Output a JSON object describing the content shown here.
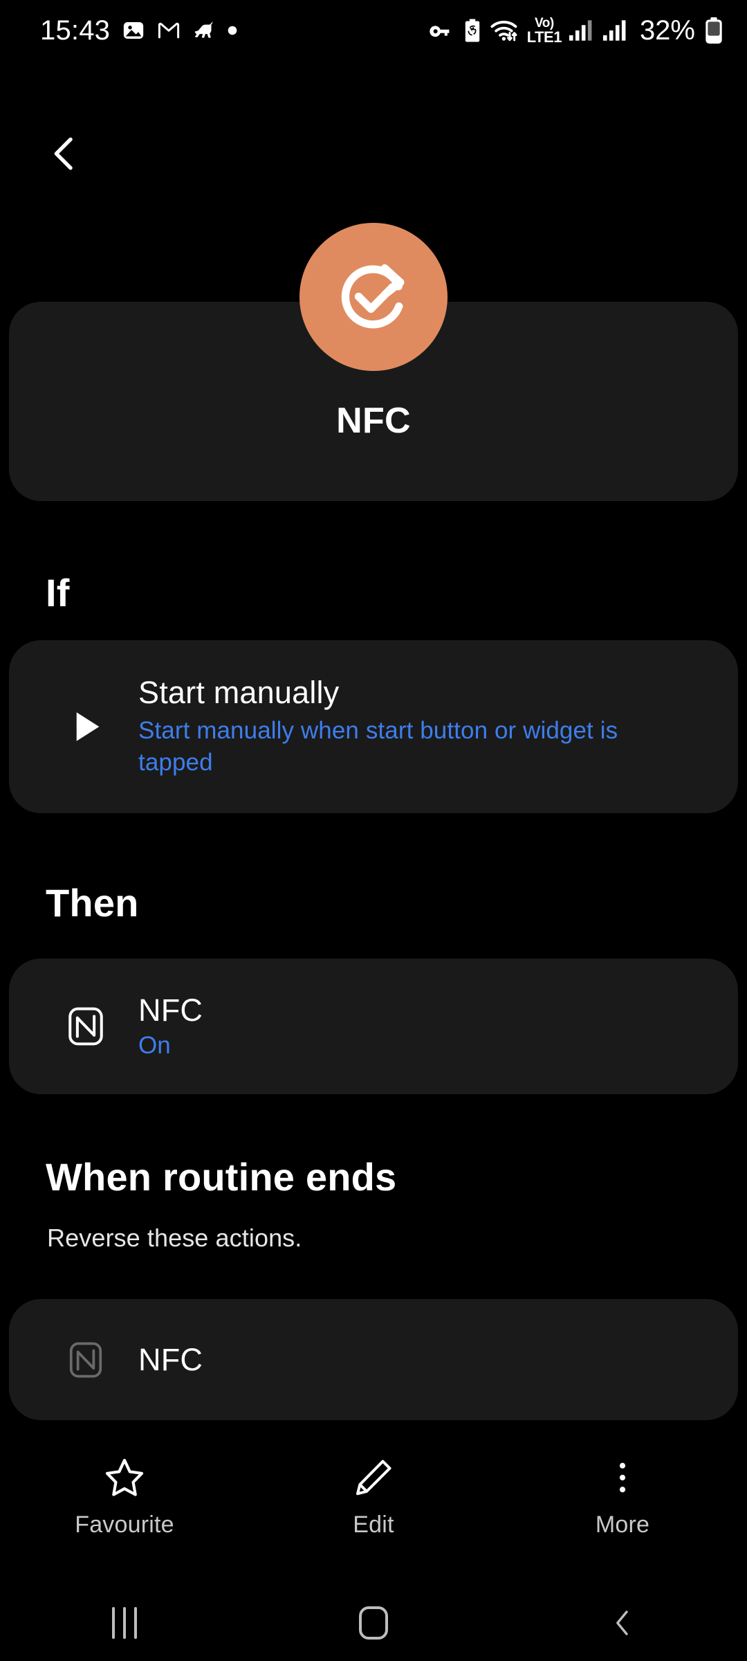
{
  "status_bar": {
    "clock": "15:43",
    "battery_percent": "32%",
    "volte_top": "Vo)",
    "volte_bottom": "LTE1",
    "left_icons": [
      "photo-icon",
      "gmail-icon",
      "horse-icon",
      "dot-icon"
    ],
    "right_icons": [
      "vpn-key-icon",
      "battery-saver-icon",
      "wifi-icon",
      "volte-icon",
      "signal-sim1-icon",
      "signal-sim2-icon",
      "battery-icon"
    ]
  },
  "nav": {
    "back_icon": "back-chevron-icon"
  },
  "header": {
    "badge_icon": "routine-refresh-check-icon",
    "badge_color": "#e08b5f",
    "title": "NFC"
  },
  "sections": {
    "if": {
      "heading": "If",
      "row": {
        "icon": "play-triangle-icon",
        "title": "Start manually",
        "subtitle": "Start manually when start button or widget is tapped"
      }
    },
    "then": {
      "heading": "Then",
      "row": {
        "icon": "nfc-icon",
        "title": "NFC",
        "subtitle": "On"
      }
    },
    "routine_ends": {
      "heading": "When routine ends",
      "description": "Reverse these actions.",
      "row": {
        "icon": "nfc-icon-dimmed",
        "title": "NFC"
      }
    }
  },
  "action_bar": [
    {
      "icon": "star-outline-icon",
      "label": "Favourite"
    },
    {
      "icon": "pencil-icon",
      "label": "Edit"
    },
    {
      "icon": "more-vertical-icon",
      "label": "More"
    }
  ],
  "system_nav": [
    {
      "icon": "recents-icon"
    },
    {
      "icon": "home-icon"
    },
    {
      "icon": "back-icon"
    }
  ],
  "colors": {
    "background": "#000000",
    "card": "#1a1a1a",
    "accent_blue": "#3d7eec",
    "accent_orange": "#e08b5f",
    "dimmed_icon": "#6a6a6a"
  }
}
